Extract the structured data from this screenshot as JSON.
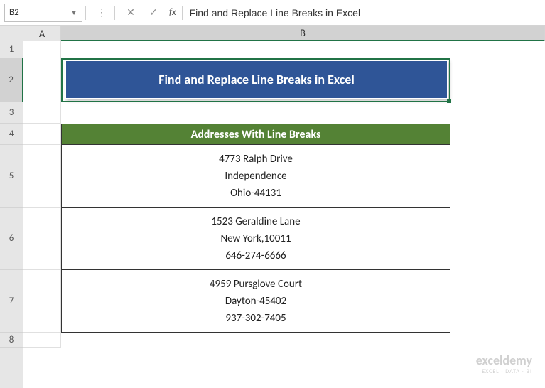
{
  "nameBox": "B2",
  "formulaBar": "Find and Replace Line Breaks in Excel",
  "colHeaders": {
    "A": "A",
    "B": "B"
  },
  "rowHeaders": {
    "1": "1",
    "2": "2",
    "3": "3",
    "4": "4",
    "5": "5",
    "6": "6",
    "7": "7",
    "8": "8"
  },
  "title": "Find and Replace Line Breaks in Excel",
  "subheader": "Addresses With Line Breaks",
  "addresses": [
    {
      "line1": "4773 Ralph Drive",
      "line2": "Independence",
      "line3": "Ohio-44131"
    },
    {
      "line1": "1523 Geraldine Lane",
      "line2": "New York,10011",
      "line3": "646-274-6666"
    },
    {
      "line1": "4959 Pursglove Court",
      "line2": "Dayton-45402",
      "line3": "937-302-7405"
    }
  ],
  "watermark": {
    "brand": "exceldemy",
    "tagline": "EXCEL · DATA · BI"
  },
  "icons": {
    "dropdown": "▼",
    "cancel": "✕",
    "enter": "✓",
    "fx": "fx"
  },
  "layout": {
    "colA": 53,
    "colB": 548,
    "rows": {
      "1": 24,
      "2": 62,
      "3": 30,
      "4": 30,
      "5": 88,
      "6": 88,
      "7": 88,
      "8": 22
    }
  }
}
